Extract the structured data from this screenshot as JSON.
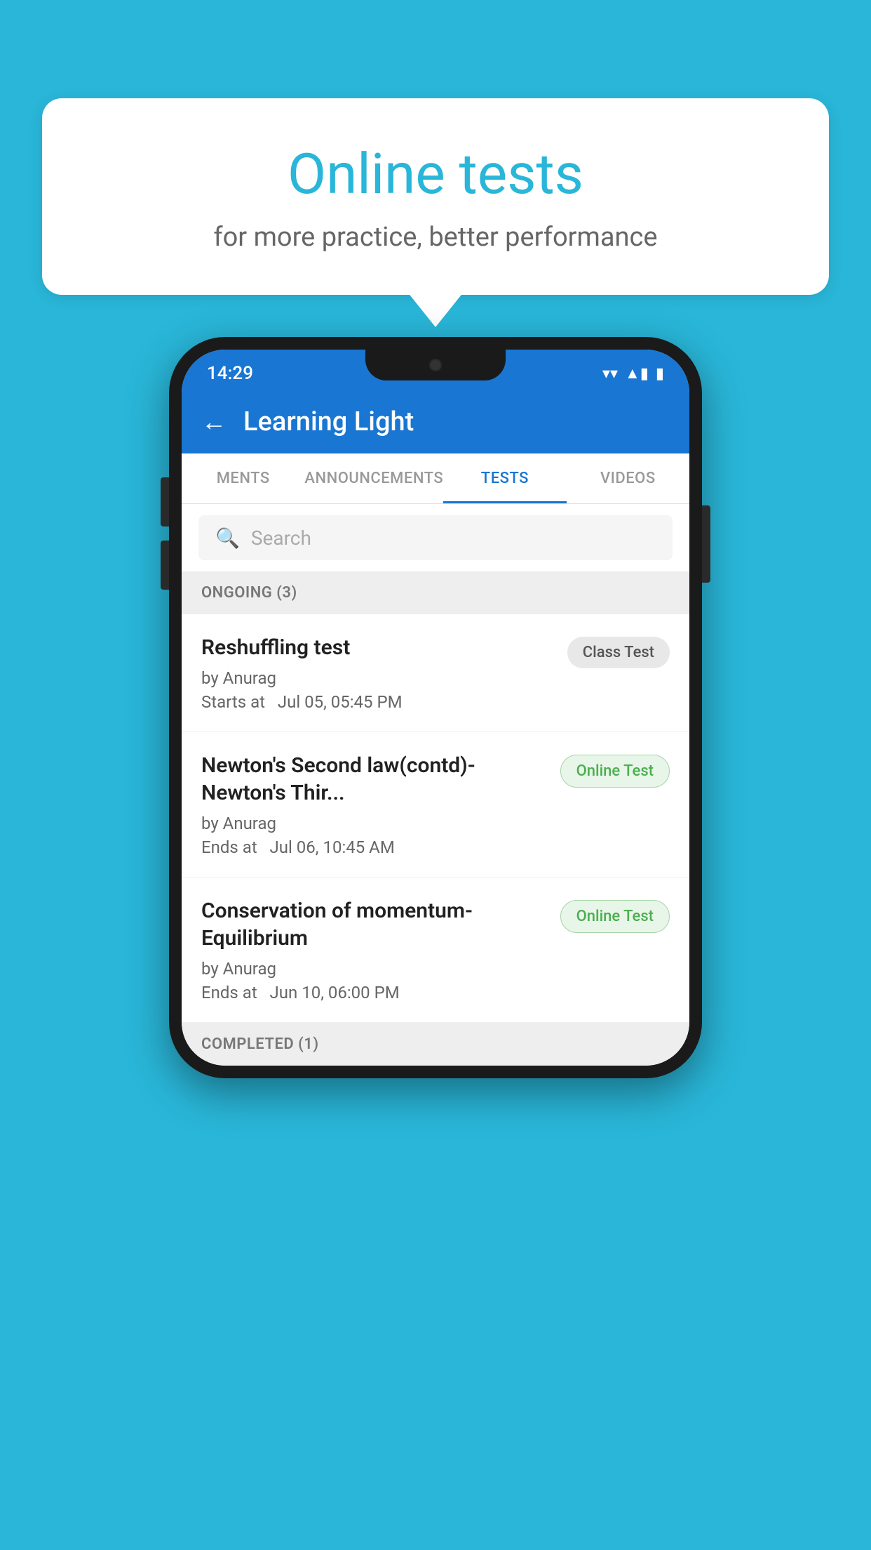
{
  "background_color": "#29b6d8",
  "speech_bubble": {
    "title": "Online tests",
    "subtitle": "for more practice, better performance"
  },
  "phone": {
    "status_bar": {
      "time": "14:29",
      "wifi_icon": "▼",
      "signal_icon": "▲",
      "battery_icon": "▮"
    },
    "app_bar": {
      "back_label": "←",
      "title": "Learning Light"
    },
    "tabs": [
      {
        "label": "MENTS",
        "active": false
      },
      {
        "label": "ANNOUNCEMENTS",
        "active": false
      },
      {
        "label": "TESTS",
        "active": true
      },
      {
        "label": "VIDEOS",
        "active": false
      }
    ],
    "search": {
      "placeholder": "Search"
    },
    "sections": [
      {
        "header": "ONGOING (3)",
        "items": [
          {
            "name": "Reshuffling test",
            "author": "by Anurag",
            "time_label": "Starts at",
            "time": "Jul 05, 05:45 PM",
            "badge": "Class Test",
            "badge_type": "class"
          },
          {
            "name": "Newton's Second law(contd)-Newton's Thir...",
            "author": "by Anurag",
            "time_label": "Ends at",
            "time": "Jul 06, 10:45 AM",
            "badge": "Online Test",
            "badge_type": "online"
          },
          {
            "name": "Conservation of momentum-Equilibrium",
            "author": "by Anurag",
            "time_label": "Ends at",
            "time": "Jun 10, 06:00 PM",
            "badge": "Online Test",
            "badge_type": "online"
          }
        ]
      }
    ],
    "completed_header": "COMPLETED (1)"
  }
}
